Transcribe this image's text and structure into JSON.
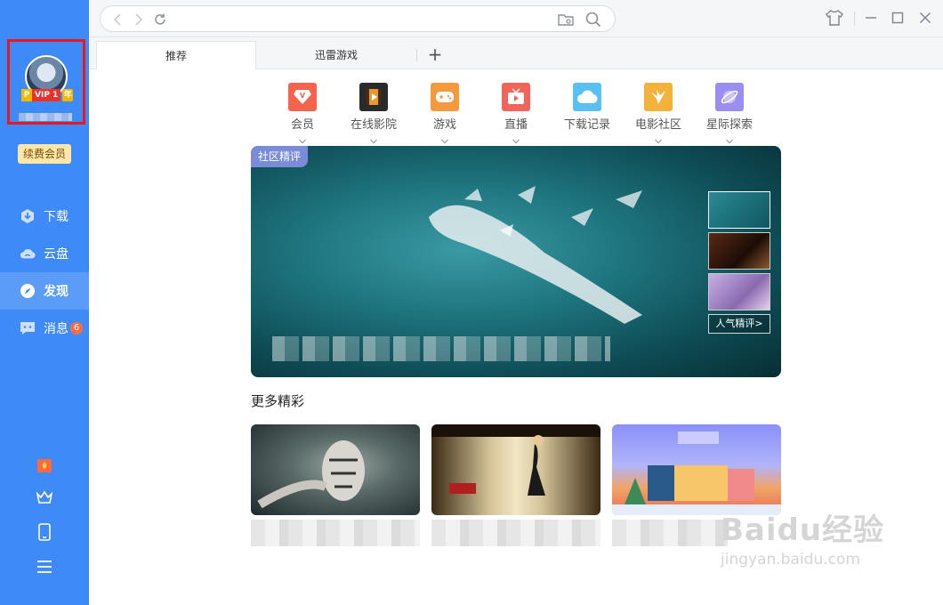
{
  "sidebar": {
    "vip_badge": {
      "p": "P",
      "vip": "VIP 1",
      "year": "年"
    },
    "renew_button": "续费会员",
    "items": [
      {
        "label": "下载",
        "icon": "download-icon"
      },
      {
        "label": "云盘",
        "icon": "cloud-icon"
      },
      {
        "label": "发现",
        "icon": "compass-icon"
      },
      {
        "label": "消息",
        "icon": "message-icon",
        "badge": "6"
      }
    ],
    "bottom_icons": [
      "fire-gift-icon",
      "crown-icon",
      "phone-icon",
      "menu-icon"
    ],
    "accent": "#3e8af6",
    "active_item": "发现"
  },
  "tabs": [
    {
      "label": "推荐",
      "active": true
    },
    {
      "label": "迅雷游戏",
      "active": false
    }
  ],
  "quick_icons": [
    {
      "label": "会员",
      "color": "#f4634c",
      "has_menu": true
    },
    {
      "label": "在线影院",
      "color": "#2a2a2a",
      "has_menu": true
    },
    {
      "label": "游戏",
      "color": "#f59a3c",
      "has_menu": true
    },
    {
      "label": "直播",
      "color": "#f2635a",
      "has_menu": true
    },
    {
      "label": "下载记录",
      "color": "#58c1f2",
      "has_menu": false
    },
    {
      "label": "电影社区",
      "color": "#f3b23a",
      "has_menu": true
    },
    {
      "label": "星际探索",
      "color": "#9a8ef2",
      "has_menu": true
    }
  ],
  "banner": {
    "tag": "社区精评",
    "hot_link": "人气精评>"
  },
  "more_section": {
    "title": "更多精彩"
  },
  "watermark": {
    "logo": "Baidu经验",
    "url": "jingyan.baidu.com"
  }
}
